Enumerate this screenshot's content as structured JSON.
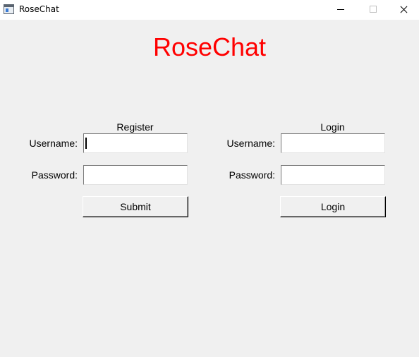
{
  "window": {
    "title": "RoseChat"
  },
  "heading": "RoseChat",
  "register": {
    "title": "Register",
    "username_label": "Username:",
    "username_value": "",
    "password_label": "Password:",
    "password_value": "",
    "submit_label": "Submit"
  },
  "login": {
    "title": "Login",
    "username_label": "Username:",
    "username_value": "",
    "password_label": "Password:",
    "password_value": "",
    "submit_label": "Login"
  },
  "colors": {
    "heading": "#ff0000",
    "background": "#f0f0f0"
  }
}
